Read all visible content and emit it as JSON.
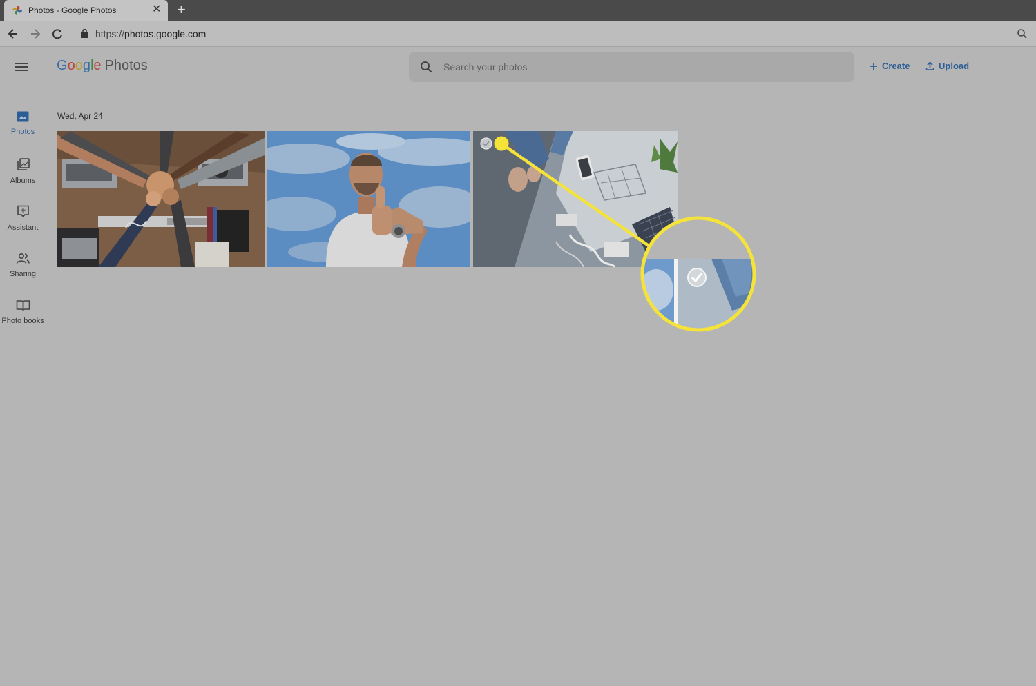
{
  "browser": {
    "tab_title": "Photos - Google Photos",
    "url_protocol": "https://",
    "url_host": "photos.google.com"
  },
  "app": {
    "logo_google": [
      "G",
      "o",
      "o",
      "g",
      "l",
      "e"
    ],
    "logo_product": "Photos",
    "search_placeholder": "Search your photos",
    "create_label": "Create",
    "upload_label": "Upload"
  },
  "sidebar": {
    "items": [
      {
        "label": "Photos",
        "icon": "photo-icon",
        "active": true
      },
      {
        "label": "Albums",
        "icon": "albums-icon",
        "active": false
      },
      {
        "label": "Assistant",
        "icon": "assistant-icon",
        "active": false
      },
      {
        "label": "Sharing",
        "icon": "sharing-icon",
        "active": false
      },
      {
        "label": "Photo books",
        "icon": "photo-books-icon",
        "active": false
      }
    ]
  },
  "content": {
    "date_label": "Wed, Apr 24",
    "photos": [
      {
        "subject": "team-hands-laptops"
      },
      {
        "subject": "man-thumbs-up-sky"
      },
      {
        "subject": "desk-blueprints-top-view",
        "hover_check": true
      }
    ]
  },
  "colors": {
    "accent": "#2d5d95",
    "callout": "#f5e33a",
    "overlay_bg": "#b5b5b5"
  }
}
